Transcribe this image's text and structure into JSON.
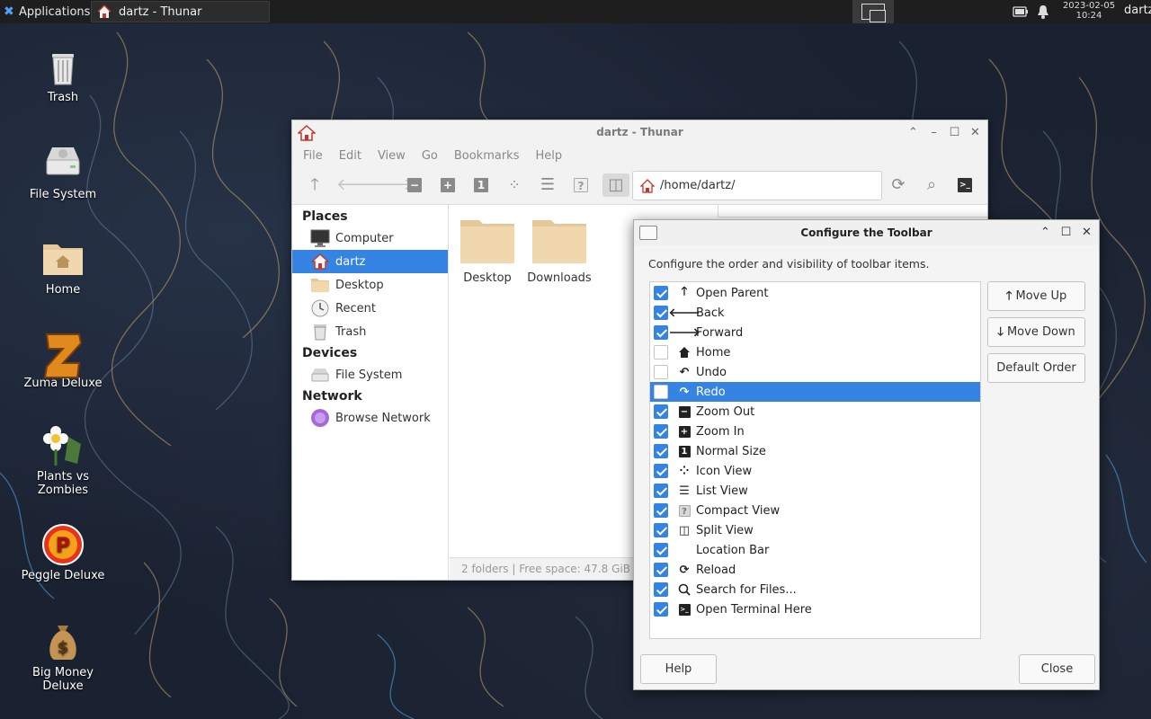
{
  "panel": {
    "applications": "Applications",
    "task_title": "dartz - Thunar",
    "clock_date": "2023-02-05",
    "clock_time": "10:24",
    "user": "dartz"
  },
  "desktop": {
    "icons": [
      {
        "label": "Trash",
        "icon": "trash-icon"
      },
      {
        "label": "File System",
        "icon": "drive-icon"
      },
      {
        "label": "Home",
        "icon": "home-folder-icon"
      },
      {
        "label": "Zuma Deluxe",
        "icon": "zuma-icon"
      },
      {
        "label": "Plants vs Zombies",
        "icon": "plants-icon"
      },
      {
        "label": "Peggle Deluxe",
        "icon": "peggle-icon"
      },
      {
        "label": "Big Money Deluxe",
        "icon": "money-bag-icon"
      }
    ]
  },
  "thunar": {
    "title": "dartz - Thunar",
    "menu": [
      "File",
      "Edit",
      "View",
      "Go",
      "Bookmarks",
      "Help"
    ],
    "location": "/home/dartz/",
    "sidebar": {
      "places_heading": "Places",
      "places": [
        "Computer",
        "dartz",
        "Desktop",
        "Recent",
        "Trash"
      ],
      "devices_heading": "Devices",
      "devices": [
        "File System"
      ],
      "network_heading": "Network",
      "network": [
        "Browse Network"
      ]
    },
    "folders": [
      "Desktop",
      "Downloads"
    ],
    "status": "2 folders  |  Free space: 47.8 GiB"
  },
  "dialog": {
    "title": "Configure the Toolbar",
    "description": "Configure the order and visibility of toolbar items.",
    "items": [
      {
        "label": "Open Parent",
        "checked": true,
        "icon": "arrow-up-icon"
      },
      {
        "label": "Back",
        "checked": true,
        "icon": "arrow-left-icon"
      },
      {
        "label": "Forward",
        "checked": true,
        "icon": "arrow-right-icon"
      },
      {
        "label": "Home",
        "checked": false,
        "icon": "home-icon"
      },
      {
        "label": "Undo",
        "checked": false,
        "icon": "undo-icon"
      },
      {
        "label": "Redo",
        "checked": false,
        "icon": "redo-icon",
        "selected": true
      },
      {
        "label": "Zoom Out",
        "checked": true,
        "icon": "zoom-out-icon"
      },
      {
        "label": "Zoom In",
        "checked": true,
        "icon": "zoom-in-icon"
      },
      {
        "label": "Normal Size",
        "checked": true,
        "icon": "normal-size-icon"
      },
      {
        "label": "Icon View",
        "checked": true,
        "icon": "icon-view-icon"
      },
      {
        "label": "List View",
        "checked": true,
        "icon": "list-view-icon"
      },
      {
        "label": "Compact View",
        "checked": true,
        "icon": "compact-view-icon"
      },
      {
        "label": "Split View",
        "checked": true,
        "icon": "split-view-icon"
      },
      {
        "label": "Location Bar",
        "checked": true,
        "icon": ""
      },
      {
        "label": "Reload",
        "checked": true,
        "icon": "reload-icon"
      },
      {
        "label": "Search for Files...",
        "checked": true,
        "icon": "search-icon"
      },
      {
        "label": "Open Terminal Here",
        "checked": true,
        "icon": "terminal-icon"
      }
    ],
    "move_up": "Move Up",
    "move_down": "Move Down",
    "default_order": "Default Order",
    "help": "Help",
    "close": "Close"
  },
  "colors": {
    "accent": "#3584e4",
    "panel": "#1e1e1e",
    "desktop": "#1a2130"
  }
}
